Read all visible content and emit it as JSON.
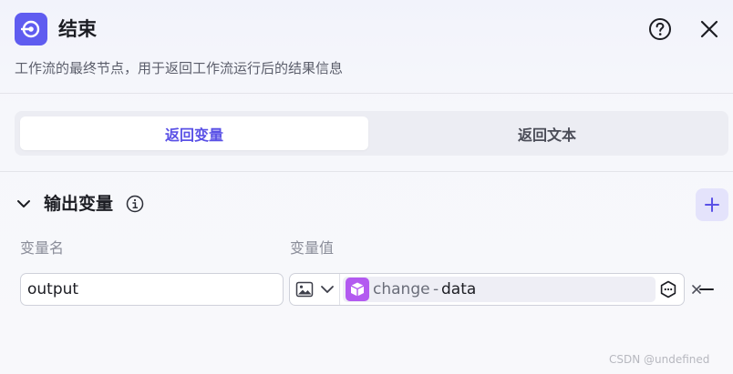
{
  "header": {
    "title": "结束",
    "description": "工作流的最终节点，用于返回工作流运行后的结果信息",
    "node_icon": "end-node-icon",
    "help_icon": "question-circle-icon",
    "close_icon": "close-icon"
  },
  "tabs": [
    {
      "label": "返回变量",
      "active": true
    },
    {
      "label": "返回文本",
      "active": false
    }
  ],
  "output_section": {
    "title": "输出变量",
    "info_icon": "info-circle-icon",
    "add_icon": "plus-icon",
    "columns": {
      "name": "变量名",
      "value": "变量值"
    },
    "rows": [
      {
        "name": "output",
        "value_type_icon": "image-icon",
        "reference": {
          "node": "change",
          "separator": "-",
          "variable": "data"
        },
        "clear_icon": "x-icon",
        "picker_icon": "variable-picker-icon",
        "remove_icon": "minus-icon"
      }
    ]
  },
  "watermark": "CSDN @undefined",
  "colors": {
    "accent": "#5f5cf0",
    "accent_text": "#5a51e6",
    "ref_node_icon": "#b35af0",
    "add_button_bg": "#e4e3fb"
  }
}
